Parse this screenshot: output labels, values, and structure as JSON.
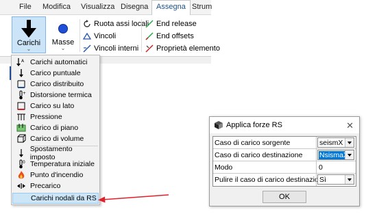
{
  "menubar": {
    "items": [
      "File",
      "Modifica",
      "Visualizza",
      "Disegna",
      "Assegna",
      "Strum"
    ],
    "active": "Assegna"
  },
  "ribbon": {
    "carichi_label": "Carichi",
    "masse_label": "Masse",
    "ruota_label": "Ruota assi locali",
    "vincoli_label": "Vincoli",
    "vincoli_interni_label": "Vincoli interni",
    "end_release_label": "End release",
    "end_offsets_label": "End offsets",
    "proprieta_label": "Proprietà elemento"
  },
  "dropdown": {
    "items": [
      {
        "label": "Carichi automatici",
        "icon": "auto-loads-icon"
      },
      {
        "label": "Carico puntuale",
        "icon": "point-load-icon"
      },
      {
        "label": "Carico distribuito",
        "icon": "distributed-load-icon"
      },
      {
        "label": "Distorsione termica",
        "icon": "thermometer-icon"
      },
      {
        "label": "Carico su lato",
        "icon": "edge-load-icon"
      },
      {
        "label": "Pressione",
        "icon": "pressure-icon"
      },
      {
        "label": "Carico di piano",
        "icon": "floor-load-icon"
      },
      {
        "label": "Carico di volume",
        "icon": "volume-load-icon"
      },
      {
        "label": "Spostamento imposto",
        "icon": "displacement-icon"
      },
      {
        "label": "Temperatura iniziale",
        "icon": "initial-temperature-icon"
      },
      {
        "label": "Punto d'incendio",
        "icon": "fire-icon"
      },
      {
        "label": "Precarico",
        "icon": "preload-icon"
      },
      {
        "label": "Carichi nodali da RS",
        "icon": "",
        "highlighted": true
      }
    ]
  },
  "dialog": {
    "title": "Applica forze RS",
    "rows": [
      {
        "label": "Caso di carico sorgente",
        "value": "seismX",
        "type": "combo"
      },
      {
        "label": "Caso di carico destinazione",
        "value": "NsismaX",
        "type": "combo",
        "selected": true
      },
      {
        "label": "Modo",
        "value": "0",
        "type": "text"
      },
      {
        "label": "Pulire il caso di carico destinazione?",
        "value": "Sì",
        "type": "combo"
      }
    ],
    "ok_label": "OK"
  },
  "colors": {
    "accent_blue": "#1f4e98",
    "highlight": "#cde6f7",
    "arrow_red": "#e0202a",
    "selection": "#0078d7"
  }
}
